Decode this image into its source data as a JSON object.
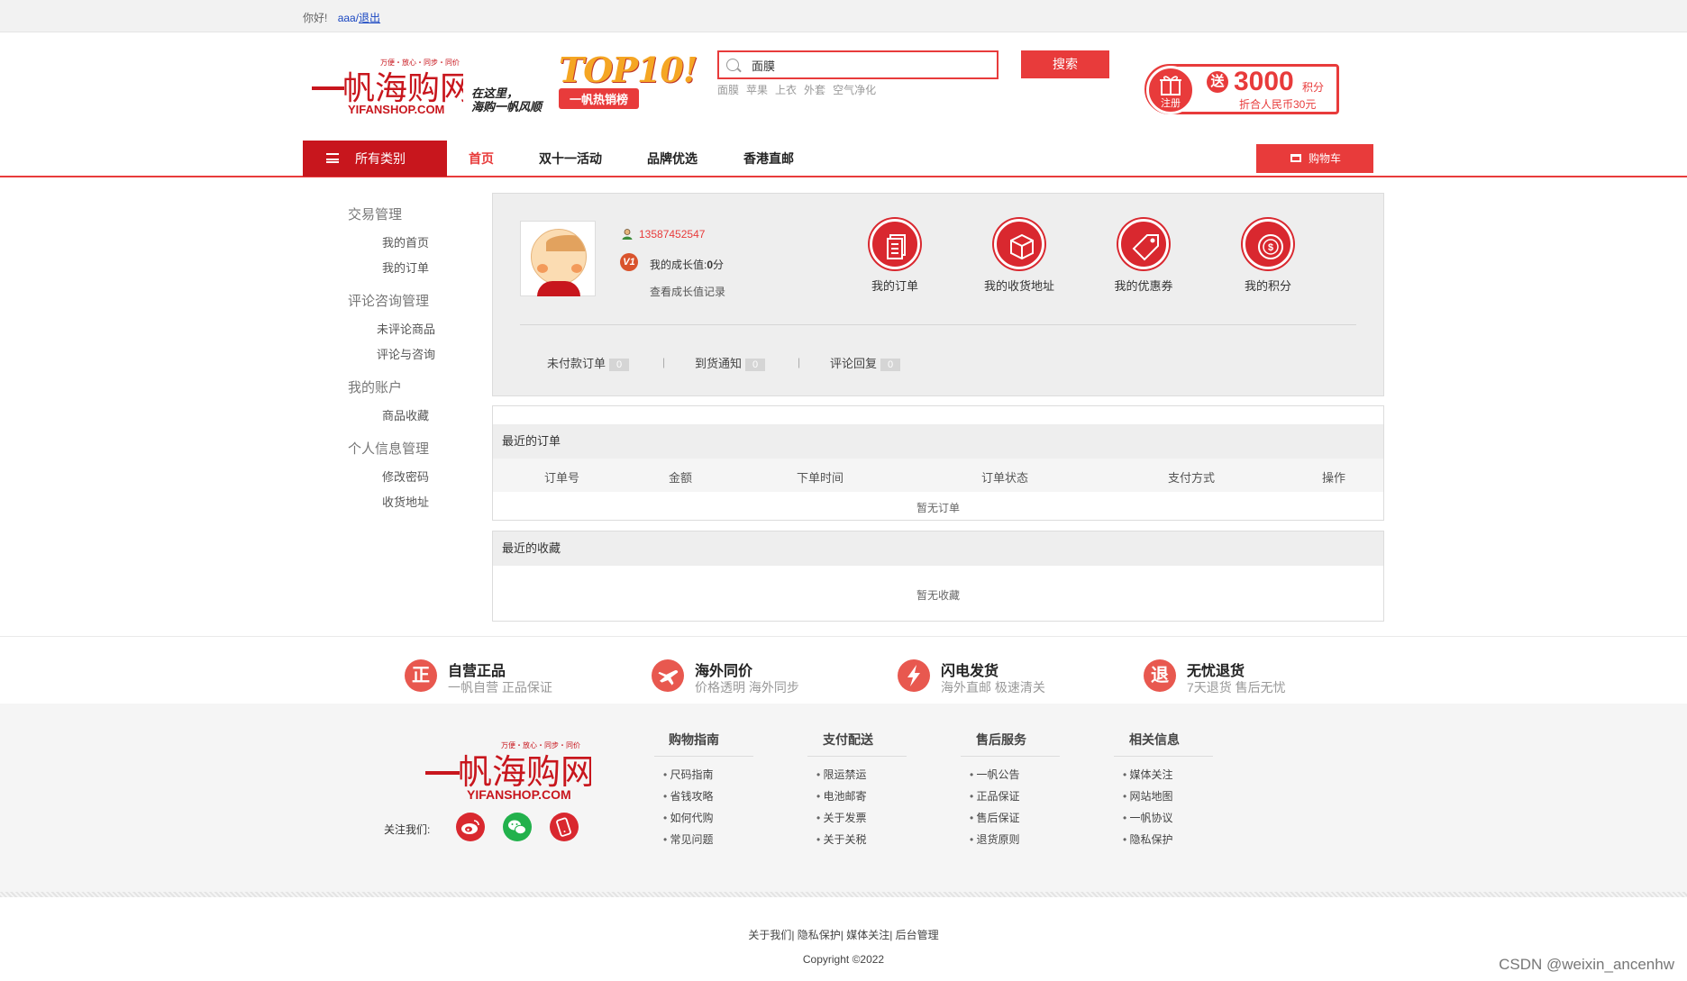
{
  "topbar": {
    "greeting": "你好!",
    "username": "aaa/",
    "logout": "退出"
  },
  "header": {
    "logo_tagline": "万便・放心・同步・同价",
    "logo_text": "一帆海购网",
    "logo_domain": "YIFANSHOP.COM",
    "slogan_line1": "在这里，",
    "slogan_line2": "海购一帆风顺",
    "top10_text": "TOP10!",
    "top10_tag": "一帆热销榜",
    "search_value": "面膜",
    "search_button": "搜索",
    "hot_words": [
      "面膜",
      "苹果",
      "上衣",
      "外套",
      "空气净化"
    ],
    "gift": {
      "register": "注册",
      "song": "送",
      "points": "3000",
      "points_unit": "积分",
      "sub": "折合人民币30元"
    }
  },
  "nav": {
    "all_categories": "所有类别",
    "items": [
      "首页",
      "双十一活动",
      "品牌优选",
      "香港直邮"
    ],
    "cart": "购物车"
  },
  "sidebar": {
    "sections": [
      {
        "title": "交易管理",
        "items": [
          "我的首页",
          "我的订单"
        ]
      },
      {
        "title": "评论咨询管理",
        "items": [
          "未评论商品",
          "评论与咨询"
        ]
      },
      {
        "title": "我的账户",
        "items": [
          "商品收藏"
        ]
      },
      {
        "title": "个人信息管理",
        "items": [
          "修改密码",
          "收货地址"
        ]
      }
    ]
  },
  "profile": {
    "phone": "13587452547",
    "v_badge": "V1",
    "growth_label": "我的成长值:",
    "growth_value": "0",
    "growth_unit": "分",
    "growth_link": "查看成长值记录",
    "quick_links": [
      {
        "label": "我的订单",
        "icon": "order-icon"
      },
      {
        "label": "我的收货地址",
        "icon": "box-icon"
      },
      {
        "label": "我的优惠券",
        "icon": "tag-icon"
      },
      {
        "label": "我的积分",
        "icon": "coin-icon"
      }
    ],
    "stats": [
      {
        "label": "未付款订单",
        "count": "0"
      },
      {
        "label": "到货通知",
        "count": "0"
      },
      {
        "label": "评论回复",
        "count": "0"
      }
    ],
    "separator": "|"
  },
  "recent_orders": {
    "title": "最近的订单",
    "columns": [
      "订单号",
      "金额",
      "下单时间",
      "订单状态",
      "支付方式",
      "操作"
    ],
    "empty": "暂无订单"
  },
  "recent_favorites": {
    "title": "最近的收藏",
    "empty": "暂无收藏"
  },
  "features": [
    {
      "icon": "正",
      "title": "自营正品",
      "sub": "一帆自营 正品保证"
    },
    {
      "icon": "plane-icon",
      "title": "海外同价",
      "sub": "价格透明 海外同步"
    },
    {
      "icon": "lightning-icon",
      "title": "闪电发货",
      "sub": "海外直邮 极速清关"
    },
    {
      "icon": "退",
      "title": "无忧退货",
      "sub": "7天退货 售后无忧"
    }
  ],
  "footer": {
    "follow_label": "关注我们:",
    "columns": [
      {
        "title": "购物指南",
        "items": [
          "尺码指南",
          "省钱攻略",
          "如何代购",
          "常见问题"
        ]
      },
      {
        "title": "支付配送",
        "items": [
          "限运禁运",
          "电池邮寄",
          "关于发票",
          "关于关税"
        ]
      },
      {
        "title": "售后服务",
        "items": [
          "一帆公告",
          "正品保证",
          "售后保证",
          "退货原则"
        ]
      },
      {
        "title": "相关信息",
        "items": [
          "媒体关注",
          "网站地图",
          "一帆协议",
          "隐私保护"
        ]
      }
    ],
    "bottom_links": "关于我们| 隐私保护| 媒体关注| 后台管理",
    "copyright": "Copyright ©2022"
  },
  "watermark": "CSDN @weixin_ancenhw",
  "colors": {
    "brand_red": "#e83b3b",
    "dark_red": "#c8161d",
    "panel_gray": "#eeeeee"
  }
}
